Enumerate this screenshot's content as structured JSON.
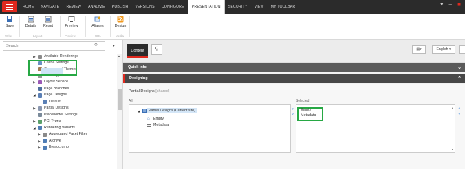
{
  "nav": {
    "tabs": [
      "HOME",
      "NAVIGATE",
      "REVIEW",
      "ANALYZE",
      "PUBLISH",
      "VERSIONS",
      "CONFIGURE",
      "PRESENTATION",
      "SECURITY",
      "VIEW",
      "MY TOOLBAR"
    ],
    "active_tab": "PRESENTATION"
  },
  "ribbon": {
    "save": "Save",
    "details": "Details",
    "reset": "Reset",
    "preview": "Preview",
    "aliases": "Aliases",
    "design": "Design",
    "groups": {
      "write": "Write",
      "layout": "Layout",
      "preview": "Preview",
      "url": "URL",
      "media": "Media"
    }
  },
  "sidebar": {
    "search_placeholder": "Search",
    "tree": [
      {
        "label": "Available Renderings",
        "arrow": "▶"
      },
      {
        "label": "Cache Settings",
        "arrow": ""
      },
      {
        "label": "Component Themes",
        "arrow": ""
      },
      {
        "label": "Event Types",
        "arrow": ""
      },
      {
        "label": "Layout Service",
        "arrow": "▶"
      },
      {
        "label": "Page Branches",
        "arrow": ""
      },
      {
        "label": "Page Designs",
        "arrow": "◢"
      },
      {
        "label": "Default",
        "arrow": ""
      },
      {
        "label": "Partial Designs",
        "arrow": "▶"
      },
      {
        "label": "Placeholder Settings",
        "arrow": ""
      },
      {
        "label": "PCI Types",
        "arrow": "▶"
      },
      {
        "label": "Rendering Variants",
        "arrow": "◢"
      },
      {
        "label": "Aggregated Facet Filter",
        "arrow": "▶"
      },
      {
        "label": "Archive",
        "arrow": "▶"
      },
      {
        "label": "Breadcrumb",
        "arrow": "▶"
      }
    ]
  },
  "content_toolbar": {
    "content_tab": "Content",
    "language": "English ▾"
  },
  "sections": {
    "quick_info": "Quick Info",
    "designing": "Designing"
  },
  "field": {
    "label": "Partial Designs",
    "shared": "[shared]",
    "all_label": "All",
    "selected_label": "Selected",
    "all_root": "Partial Designs (Current site)",
    "all_children": [
      "Empty",
      "Metadata"
    ],
    "selected_items": [
      "Empty",
      "Metadata"
    ]
  },
  "colors": {
    "brand_red": "#e0281d",
    "highlight_green": "#27a844",
    "link_blue": "#2f7ed8"
  }
}
